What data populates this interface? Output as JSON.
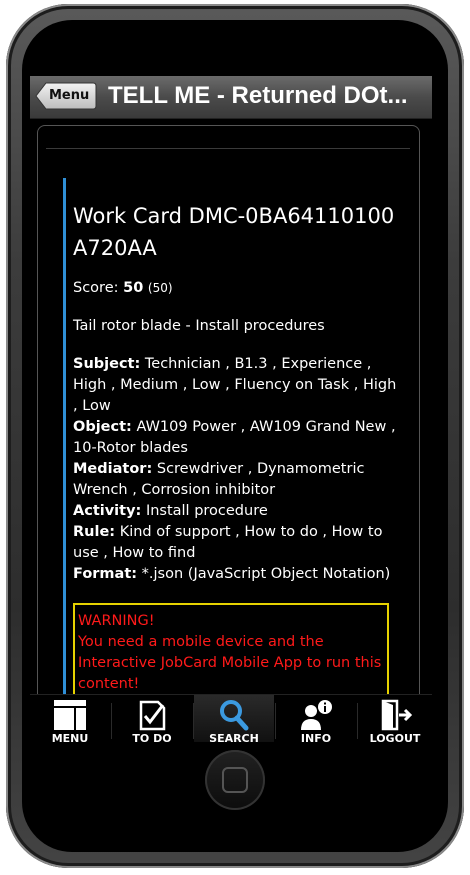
{
  "header": {
    "menu_label": "Menu",
    "title": "TELL ME - Returned DOt..."
  },
  "card": {
    "title": "Work Card DMC-0BA64110100A720AA",
    "score_label": "Score:",
    "score_value": "50",
    "score_max": "(50)",
    "description": "Tail rotor blade - Install procedures",
    "properties": [
      {
        "label": "Subject:",
        "value": "Technician , B1.3 , Experience , High , Medium , Low , Fluency on Task , High , Low"
      },
      {
        "label": "Object:",
        "value": "AW109 Power , AW109 Grand New , 10-Rotor blades"
      },
      {
        "label": "Mediator:",
        "value": "Screwdriver , Dynamometric Wrench , Corrosion inhibitor"
      },
      {
        "label": "Activity:",
        "value": "Install procedure"
      },
      {
        "label": "Rule:",
        "value": "Kind of support , How to do , How to use , How to find"
      },
      {
        "label": "Format:",
        "value": "*.json (JavaScript Object Notation)"
      }
    ],
    "warning_title": "WARNING!",
    "warning_text": "You need a mobile device and the Interactive JobCard Mobile App to run this content!"
  },
  "tabs": [
    {
      "label": "MENU",
      "icon": "menu-grid-icon"
    },
    {
      "label": "TO DO",
      "icon": "checklist-icon"
    },
    {
      "label": "SEARCH",
      "icon": "search-icon",
      "active": true
    },
    {
      "label": "INFO",
      "icon": "info-user-icon"
    },
    {
      "label": "LOGOUT",
      "icon": "logout-icon"
    }
  ],
  "colors": {
    "accent": "#2f8fd6",
    "warning_border": "#e6d200",
    "warning_text": "#ff1a1a"
  }
}
